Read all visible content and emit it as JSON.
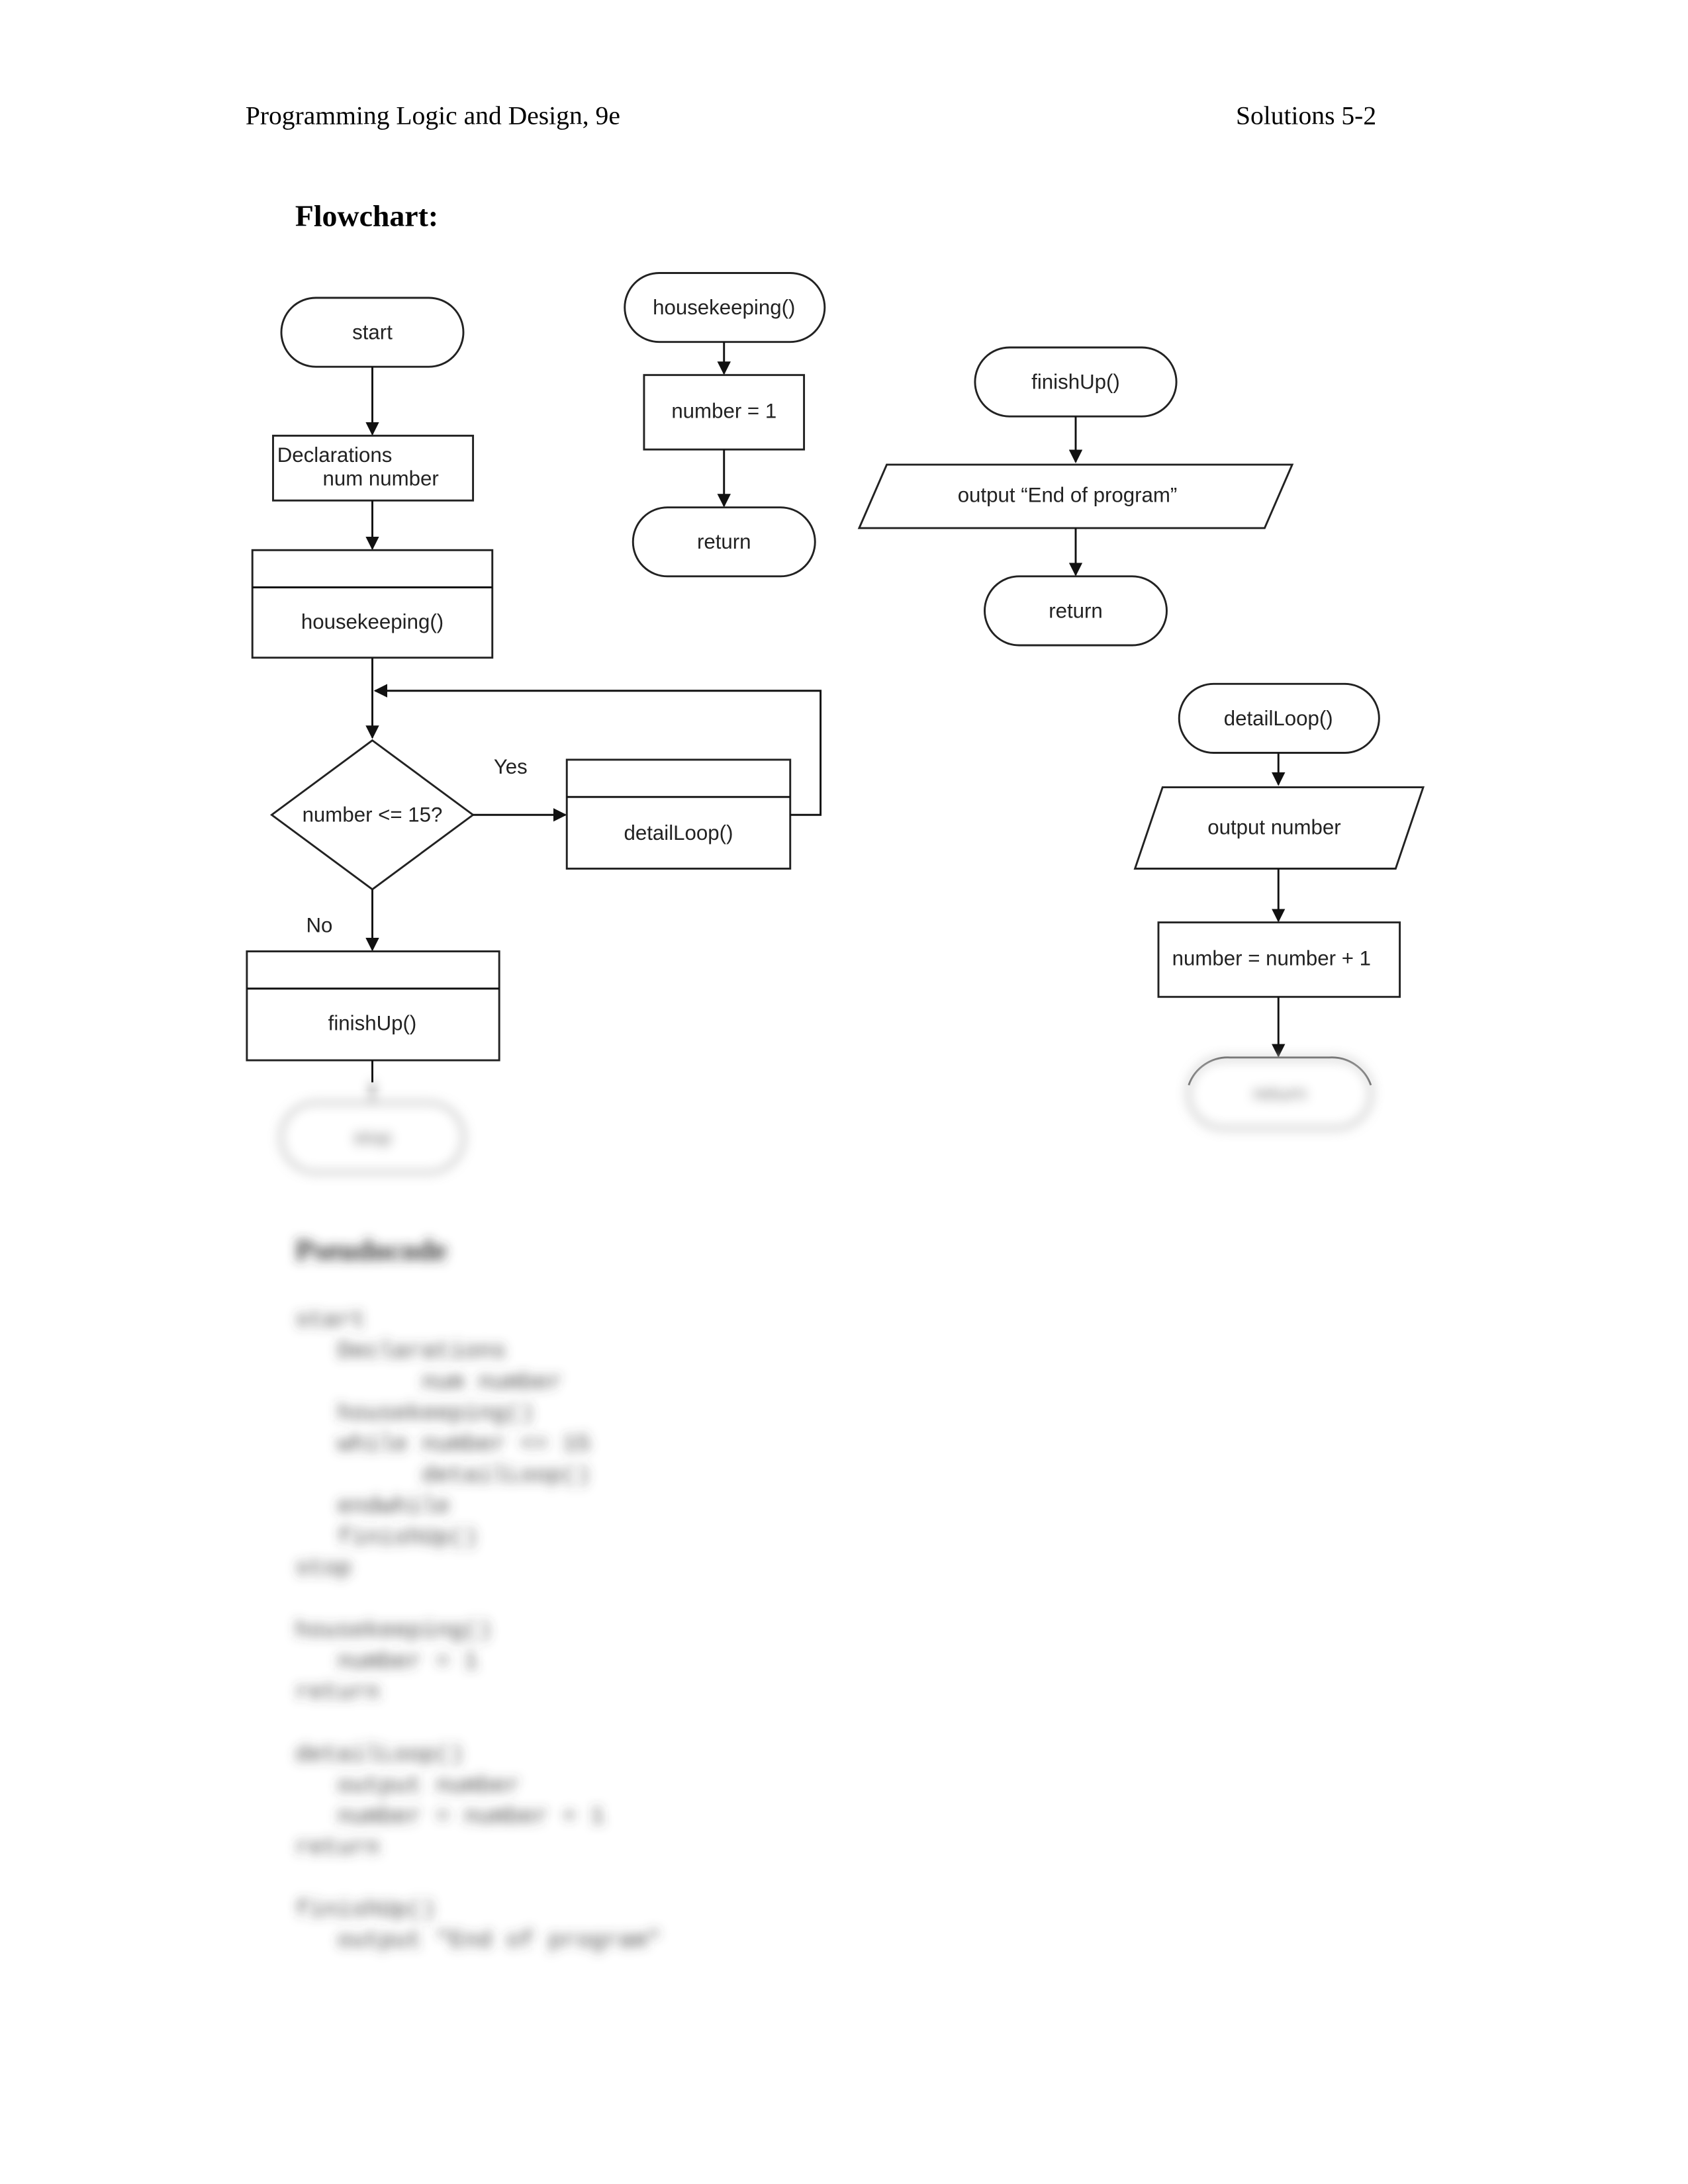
{
  "header": {
    "left": "Programming Logic and Design, 9e",
    "right": "Solutions 5-2"
  },
  "flowchart": {
    "heading": "Flowchart:",
    "main": {
      "start": "start",
      "declarations_line1": "Declarations",
      "declarations_line2": "num number",
      "housekeeping_call": "housekeeping()",
      "decision": "number <= 15?",
      "yes_label": "Yes",
      "no_label": "No",
      "detail_call": "detailLoop()",
      "finish_call": "finishUp()",
      "stop": "stop"
    },
    "housekeeping": {
      "title": "housekeeping()",
      "step": "number = 1",
      "end": "return"
    },
    "finishUp": {
      "title": "finishUp()",
      "step": "output “End of program”",
      "end": "return"
    },
    "detailLoop": {
      "title": "detailLoop()",
      "step1": "output number",
      "step2": "number = number + 1",
      "end": "return"
    }
  },
  "pseudocode": {
    "heading": "Pseudocode",
    "lines": [
      "start",
      "   Declarations",
      "         num number",
      "   housekeeping()",
      "   while number <= 15",
      "         detailLoop()",
      "   endwhile",
      "   finishUp()",
      "stop",
      "",
      "housekeeping()",
      "   number = 1",
      "return",
      "",
      "detailLoop()",
      "   output number",
      "   number = number + 1",
      "return",
      "",
      "finishUp()",
      "   output \"End of program\""
    ]
  }
}
